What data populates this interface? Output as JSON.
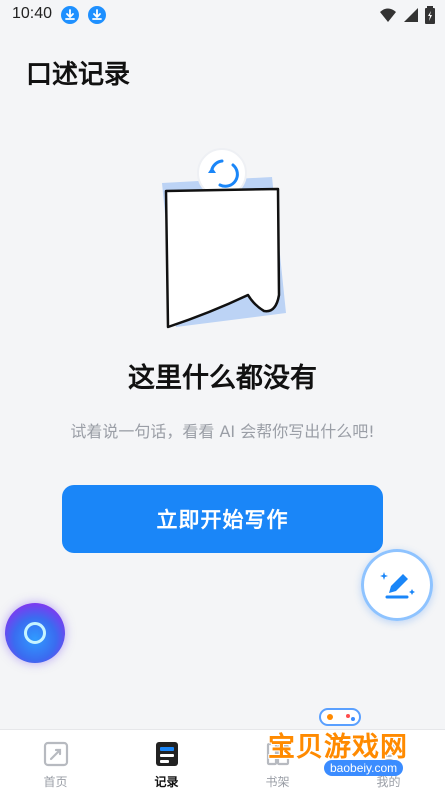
{
  "status_bar": {
    "time": "10:40",
    "icons": [
      "download-icon",
      "download-icon",
      "wifi-icon",
      "signal-icon",
      "battery-icon"
    ]
  },
  "header": {
    "title": "口述记录"
  },
  "empty_state": {
    "illustration": "blank-document-refresh-icon",
    "title": "这里什么都没有",
    "subtitle": "试着说一句话，看看 AI 会帮你写出什么吧!"
  },
  "primary_action": {
    "label": "立即开始写作"
  },
  "floating": {
    "edit_icon": "pen-sparkle-icon",
    "assistant_icon": "voice-orb-icon"
  },
  "bottom_nav": {
    "items": [
      {
        "label": "首页",
        "icon": "home-icon",
        "active": false
      },
      {
        "label": "记录",
        "icon": "record-icon",
        "active": true
      },
      {
        "label": "书架",
        "icon": "bookshelf-icon",
        "active": false
      },
      {
        "label": "我的",
        "icon": "profile-icon",
        "active": false
      }
    ]
  },
  "watermark": {
    "text": "宝贝游戏网",
    "url": "baobeiy.com"
  },
  "colors": {
    "accent": "#1a86f8",
    "background": "#f4f5f7",
    "muted_text": "#9a9ea6"
  }
}
